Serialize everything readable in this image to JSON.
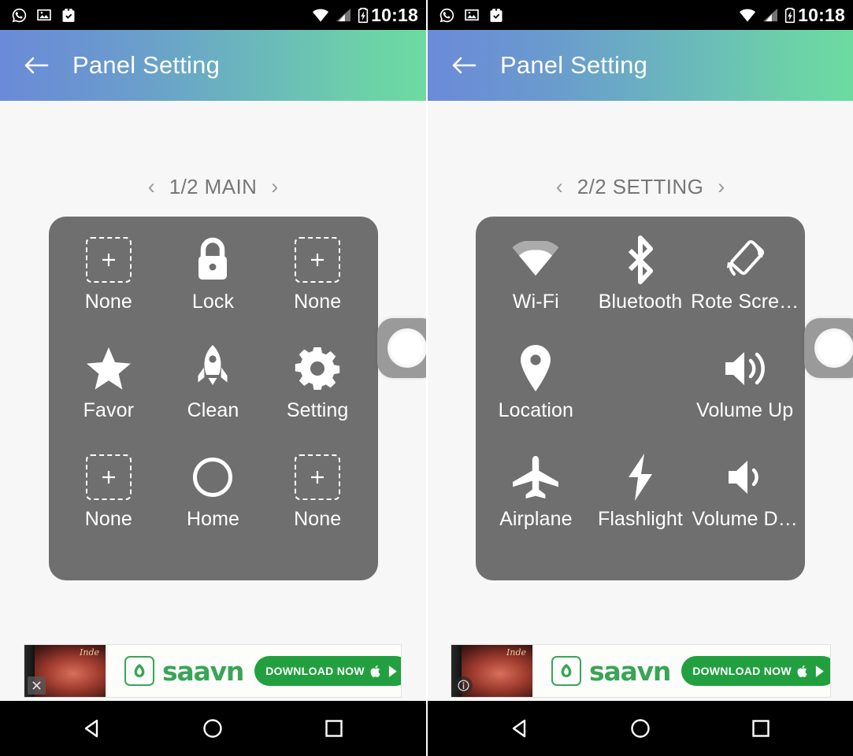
{
  "statusbar": {
    "time": "10:18",
    "left_icons": [
      "whatsapp-icon",
      "photo-icon",
      "clipboard-check-icon"
    ],
    "right_icons": [
      "wifi-icon",
      "cellular-signal-icon",
      "battery-charging-icon"
    ]
  },
  "appbar": {
    "title": "Panel Setting",
    "back_label": "←",
    "gradient_start": "#6b8ad8",
    "gradient_end": "#6ddba0"
  },
  "panels": [
    {
      "pager": {
        "prev": "‹",
        "next": "›",
        "label": "1/2 MAIN"
      },
      "panel_color": "#6f6f6f",
      "items": [
        {
          "label": "None",
          "icon": "add-placeholder-icon"
        },
        {
          "label": "Lock",
          "icon": "lock-icon"
        },
        {
          "label": "None",
          "icon": "add-placeholder-icon"
        },
        {
          "label": "Favor",
          "icon": "star-icon"
        },
        {
          "label": "Clean",
          "icon": "rocket-icon"
        },
        {
          "label": "Setting",
          "icon": "gear-icon"
        },
        {
          "label": "None",
          "icon": "add-placeholder-icon"
        },
        {
          "label": "Home",
          "icon": "home-circle-icon"
        },
        {
          "label": "None",
          "icon": "add-placeholder-icon"
        }
      ],
      "ad_badge": "close-icon"
    },
    {
      "pager": {
        "prev": "‹",
        "next": "›",
        "label": "2/2 SETTING"
      },
      "panel_color": "#6f6f6f",
      "items": [
        {
          "label": "Wi-Fi",
          "icon": "wifi-icon"
        },
        {
          "label": "Bluetooth",
          "icon": "bluetooth-icon"
        },
        {
          "label": "Rote Scre…",
          "icon": "rotate-screen-icon"
        },
        {
          "label": "Location",
          "icon": "location-pin-icon"
        },
        {
          "label": "",
          "icon": "empty-slot"
        },
        {
          "label": "Volume Up",
          "icon": "volume-up-icon"
        },
        {
          "label": "Airplane",
          "icon": "airplane-icon"
        },
        {
          "label": "Flashlight",
          "icon": "flashlight-icon"
        },
        {
          "label": "Volume D…",
          "icon": "volume-down-icon"
        }
      ],
      "ad_badge": "info-icon"
    }
  ],
  "float_ball": {
    "name": "floating-assistive-ball"
  },
  "ad": {
    "brand": "saavn",
    "cta": "DOWNLOAD NOW",
    "thumb_script": "Inde",
    "store_icons": [
      "apple-icon",
      "play-store-icon"
    ],
    "brand_color": "#3aa557",
    "cta_color": "#22a03f"
  },
  "navbar": {
    "back": "back-triangle-icon",
    "home": "home-circle-icon",
    "recents": "recents-square-icon"
  }
}
